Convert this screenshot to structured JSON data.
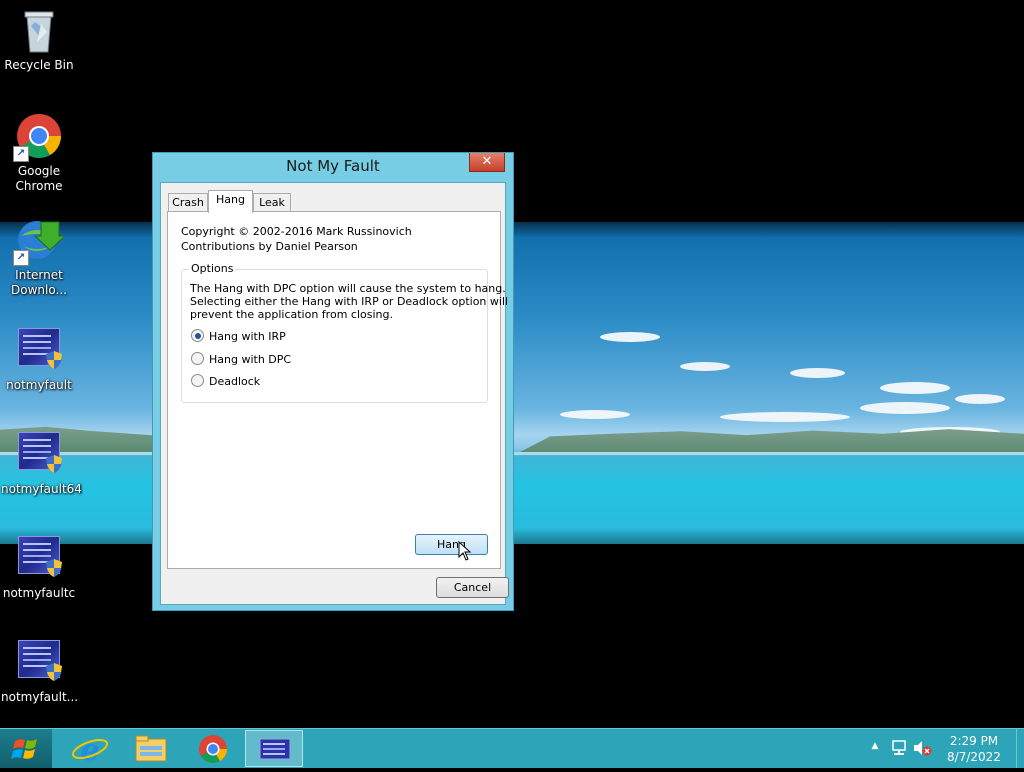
{
  "desktop": {
    "icons": [
      {
        "label": "Recycle Bin"
      },
      {
        "label": "Google Chrome"
      },
      {
        "label": "Internet Downlo..."
      },
      {
        "label": "notmyfault"
      },
      {
        "label": "notmyfault64"
      },
      {
        "label": "notmyfaultc"
      },
      {
        "label": "notmyfault..."
      }
    ]
  },
  "dialog": {
    "title": "Not My Fault",
    "close_glyph": "✕",
    "tabs": [
      {
        "label": "Crash",
        "active": false
      },
      {
        "label": "Hang",
        "active": true
      },
      {
        "label": "Leak",
        "active": false
      }
    ],
    "copyright": "Copyright © 2002-2016 Mark Russinovich",
    "contributions": "Contributions by Daniel Pearson",
    "options": {
      "title": "Options",
      "description": [
        "The Hang with DPC option will cause the system to hang.",
        "Selecting either the Hang with IRP or Deadlock option will",
        "prevent the application from closing."
      ],
      "radios": [
        {
          "label": "Hang with IRP",
          "checked": true
        },
        {
          "label": "Hang with DPC",
          "checked": false
        },
        {
          "label": "Deadlock",
          "checked": false
        }
      ]
    },
    "hang_button": "Hang",
    "cancel_button": "Cancel"
  },
  "taskbar": {
    "pinned": [
      "start-icon",
      "internet-explorer-icon",
      "file-explorer-icon",
      "chrome-icon",
      "notmyfault-icon"
    ],
    "time": "2:29 PM",
    "date": "8/7/2022"
  }
}
